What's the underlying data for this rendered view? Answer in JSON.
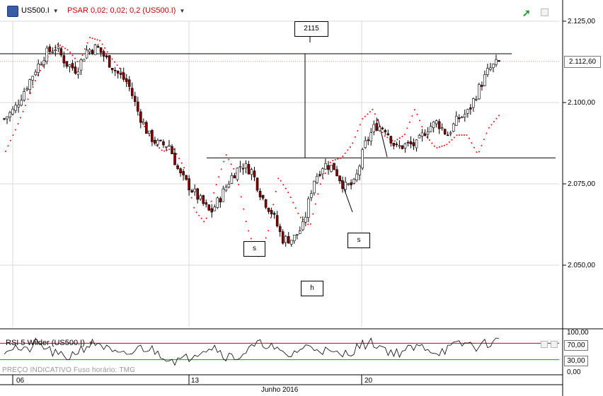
{
  "header": {
    "symbol_label": "US500.I",
    "indicator_label": "PSAR 0,02; 0,02; 0,2 (US500.I)",
    "indicator_color": "#cc0000"
  },
  "icons": {
    "symbol": "cfd-icon",
    "trend": "trend-up-arrow-icon",
    "settings": "panel-settings-icon"
  },
  "rsi_panel": {
    "label": "RSI 5 Wilder (US500.I)",
    "ticks": [
      "100,00",
      "0,00"
    ],
    "level_high": "70,00",
    "level_low": "30,00",
    "level_high_color": "#cc0000",
    "level_low_color": "#00aa00"
  },
  "footer": {
    "note": "PREÇO INDICATIVO     Fuso horário: TMG"
  },
  "price_axis": {
    "ticks": [
      "2.125,00",
      "2.100,00",
      "2.075,00",
      "2.050,00"
    ],
    "current_price": "2.112,60"
  },
  "time_axis": {
    "ticks": [
      "06",
      "13",
      "20"
    ],
    "month": "Junho 2016"
  },
  "annotations": {
    "target": "2115",
    "left_shoulder": "s",
    "head": "h",
    "right_shoulder": "s"
  },
  "colors": {
    "candle_up": "#ffffff",
    "candle_down": "#8b0000",
    "candle_outline": "#000000",
    "psar_dot": "#ff0000",
    "grid": "#d9d9d9"
  },
  "chart_data": [
    {
      "type": "candlestick",
      "title": "US500.I",
      "period": "Junho 2016",
      "ylim": [
        2030,
        2133
      ],
      "y_ticks": [
        2050,
        2075,
        2100,
        2125
      ],
      "x_ticks": [
        "06",
        "13",
        "20"
      ],
      "last_price": 2112.6,
      "close_series": [
        2095,
        2098,
        2104,
        2110,
        2115,
        2117,
        2112,
        2110,
        2116,
        2117,
        2113,
        2109,
        2106,
        2097,
        2090,
        2087,
        2087,
        2078,
        2074,
        2070,
        2066,
        2071,
        2077,
        2081,
        2079,
        2071,
        2066,
        2058,
        2058,
        2062,
        2076,
        2081,
        2080,
        2074,
        2075,
        2087,
        2093,
        2092,
        2086,
        2087,
        2087,
        2092,
        2094,
        2090,
        2095,
        2097,
        2104,
        2110,
        2112.6
      ],
      "psar": [
        2085,
        2092,
        2100,
        2108,
        2114,
        2118,
        2116,
        2112,
        2120,
        2119,
        2114,
        2110,
        2103,
        2094,
        2088,
        2085,
        2086,
        2080,
        2067,
        2063,
        2074,
        2084,
        2078,
        2062,
        2052,
        2060,
        2077,
        2072,
        2065,
        2062,
        2075,
        2082,
        2083,
        2087,
        2095,
        2098,
        2090,
        2088,
        2090,
        2098,
        2090,
        2086,
        2087,
        2090,
        2090,
        2084,
        2092,
        2096
      ],
      "lines": [
        {
          "type": "horizontal",
          "value": 2115
        },
        {
          "type": "horizontal",
          "value": 2083
        },
        {
          "type": "vertical",
          "from": 2115,
          "to": 2083
        }
      ],
      "annotations": [
        "2115",
        "s",
        "h",
        "s"
      ]
    },
    {
      "type": "line",
      "title": "RSI 5 Wilder (US500.I)",
      "ylim": [
        0,
        100
      ],
      "levels": [
        70,
        30
      ],
      "values": [
        55,
        62,
        48,
        70,
        58,
        40,
        35,
        52,
        66,
        72,
        50,
        38,
        45,
        60,
        55,
        42,
        30,
        28,
        45,
        58,
        62,
        40,
        35,
        50,
        65,
        70,
        48,
        38,
        55,
        62,
        58,
        45,
        40,
        52,
        66,
        71,
        60,
        45,
        52,
        58,
        62,
        48,
        55,
        65,
        70,
        60,
        72,
        75
      ]
    }
  ]
}
